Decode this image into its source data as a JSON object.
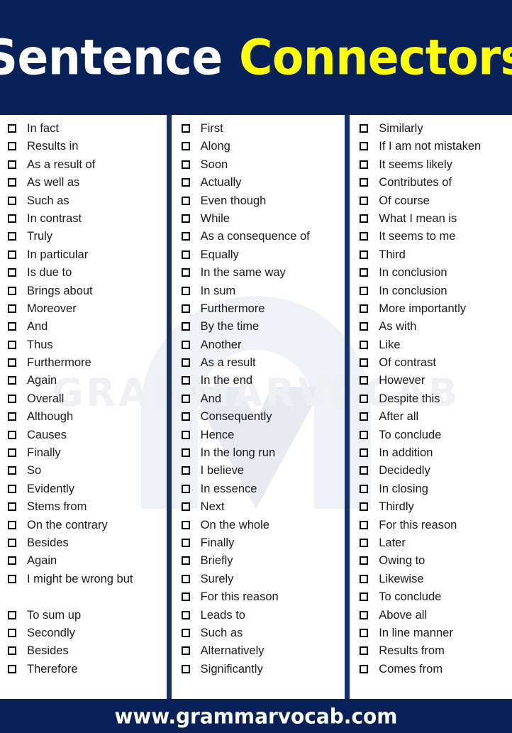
{
  "header": {
    "title_part_1": "Sentence",
    "title_part_2": "Connectors",
    "background_color": "#082159",
    "title_part_1_color": "#ffffff",
    "title_part_2_color": "#ffff00"
  },
  "watermark": {
    "text": "GRAMMARVOCAB",
    "color": "#eef0f4"
  },
  "columns": [
    {
      "id": "column-1",
      "items": [
        "In fact",
        "Results in",
        "As a result of",
        "As well as",
        "Such as",
        "In contrast",
        "Truly",
        "In particular",
        "Is due to",
        "Brings about",
        "Moreover",
        "And",
        "Thus",
        "Furthermore",
        "Again",
        "Overall",
        "Although",
        "Causes",
        "Finally",
        "So",
        "Evidently",
        "Stems from",
        "On the contrary",
        "Besides",
        "Again",
        "I might be wrong but",
        "To sum up",
        "Secondly",
        "Besides",
        "Therefore"
      ]
    },
    {
      "id": "column-2",
      "items": [
        "First",
        "Along",
        "Soon",
        "Actually",
        "Even though",
        "While",
        "As a consequence of",
        "Equally",
        "In the same way",
        "In sum",
        "Furthermore",
        "By the time",
        "Another",
        "As a result",
        "In the end",
        "And",
        "Consequently",
        "Hence",
        "In the long run",
        "I believe",
        "In essence",
        "Next",
        "On the whole",
        "Finally",
        "Briefly",
        "Surely",
        "For this reason",
        "Leads to",
        "Such as",
        "Alternatively",
        "Significantly"
      ]
    },
    {
      "id": "column-3",
      "items": [
        "Similarly",
        "If I am not mistaken",
        "It seems likely",
        "Contributes of",
        "Of course",
        "What I mean is",
        "It seems to me",
        "Third",
        "In conclusion",
        "In conclusion",
        "More importantly",
        "As with",
        "Like",
        "Of contrast",
        "However",
        "Despite this",
        "After all",
        "To conclude",
        "In addition",
        "Decidedly",
        "In closing",
        "Thirdly",
        "For this reason",
        "Later",
        "Owing to",
        "Likewise",
        "To conclude",
        "Above all",
        "In line manner",
        "Results from",
        "Comes from"
      ]
    }
  ],
  "footer": {
    "website": "www.grammarvocab.com",
    "background_color": "#082159",
    "text_color": "#ffffff"
  }
}
